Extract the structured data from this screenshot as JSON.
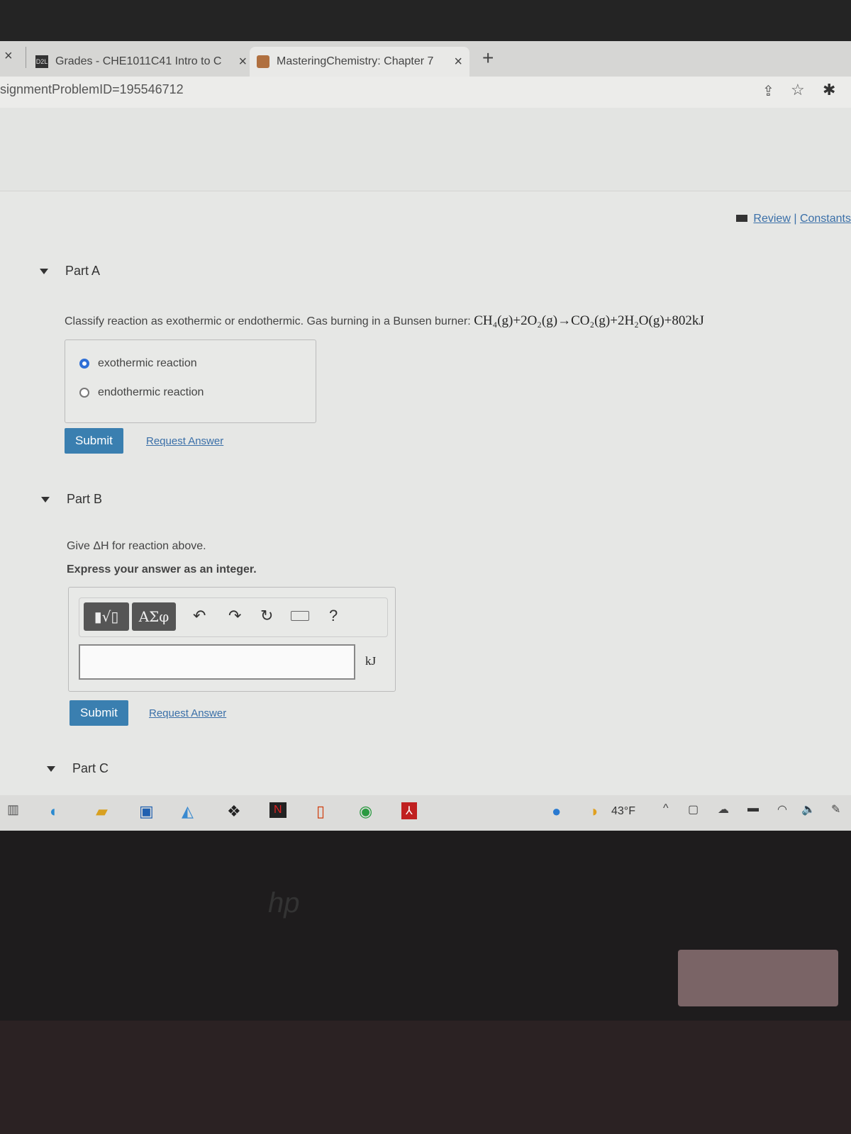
{
  "browser": {
    "tabs": [
      {
        "label": "Grades - CHE1011C41 Intro to C",
        "favicon": "D2L"
      },
      {
        "label": "MasteringChemistry: Chapter 7",
        "favicon": "mastering-icon"
      }
    ],
    "close_glyph": "×",
    "new_tab_glyph": "+",
    "address": "signmentProblemID=195546712"
  },
  "header_links": {
    "review": "Review",
    "separator": "|",
    "constants": "Constants"
  },
  "partA": {
    "title": "Part A",
    "question": "Classify reaction as exothermic or endothermic. Gas burning in a Bunsen burner:",
    "equation": "CH₄(g)+2O₂(g)→CO₂(g)+2H₂O(g)+802kJ",
    "options": [
      {
        "label": "exothermic reaction",
        "selected": true
      },
      {
        "label": "endothermic reaction",
        "selected": false
      }
    ],
    "submit": "Submit",
    "request": "Request Answer"
  },
  "partB": {
    "title": "Part B",
    "question": "Give ΔH for reaction above.",
    "instruction": "Express your answer as an integer.",
    "toolbar": {
      "templates": "▮√▯",
      "greek": "ΑΣφ",
      "help": "?"
    },
    "answer_value": "",
    "unit": "kJ",
    "submit": "Submit",
    "request": "Request Answer"
  },
  "partC": {
    "title": "Part C"
  },
  "taskbar": {
    "weather": "43°F",
    "accent": "#3a7fb0"
  },
  "laptop_logo": "hp"
}
